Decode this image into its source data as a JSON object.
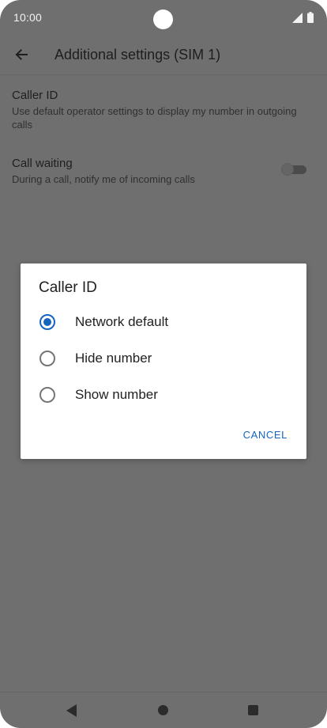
{
  "status_bar": {
    "time": "10:00"
  },
  "app_bar": {
    "title": "Additional settings (SIM 1)",
    "back_icon": "arrow-left-icon"
  },
  "settings": [
    {
      "title": "Caller ID",
      "subtitle": "Use default operator settings to display my number in outgoing calls"
    },
    {
      "title": "Call waiting",
      "subtitle": "During a call, notify me of incoming calls",
      "toggle_on": false
    }
  ],
  "dialog": {
    "title": "Caller ID",
    "options": [
      {
        "label": "Network default",
        "selected": true
      },
      {
        "label": "Hide number",
        "selected": false
      },
      {
        "label": "Show number",
        "selected": false
      }
    ],
    "cancel_label": "CANCEL"
  },
  "colors": {
    "accent": "#1565c0",
    "scrim_background": "#6f6f6f"
  }
}
